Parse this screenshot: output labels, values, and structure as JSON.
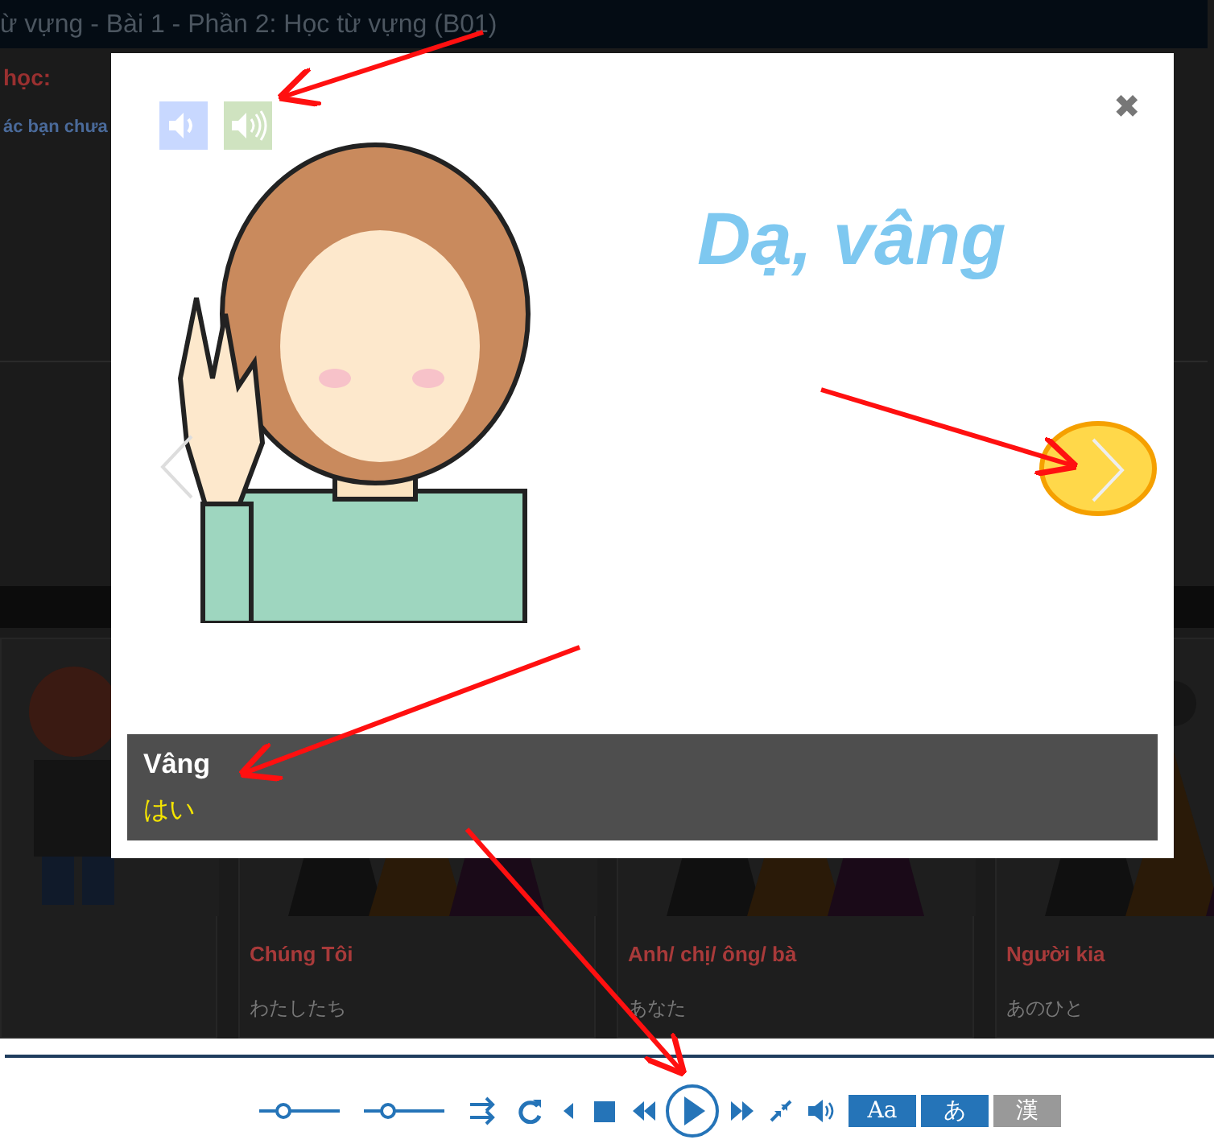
{
  "page_title": "ừ vựng - Bài 1 - Phần 2: Học từ vựng (B01)",
  "section_heading": "học:",
  "intro_text": "ác bạn chưa",
  "cards": [
    {
      "title": "Chúng Tôi",
      "reading": "わたしたち"
    },
    {
      "title": "Anh/ chị/ ông/ bà",
      "reading": "あなた"
    },
    {
      "title": "Người kia",
      "reading": "あのひと"
    }
  ],
  "lightbox": {
    "image_text": "Dạ, vâng",
    "close": "✖",
    "caption": {
      "title": "Vâng",
      "reading": "はい"
    }
  },
  "player": {
    "sliders": [
      {
        "level": 0.3
      },
      {
        "level": 0.3
      }
    ],
    "toggles": [
      {
        "label": "Aa",
        "on": true
      },
      {
        "label": "あ",
        "on": true
      },
      {
        "label": "漢",
        "on": false
      }
    ]
  }
}
